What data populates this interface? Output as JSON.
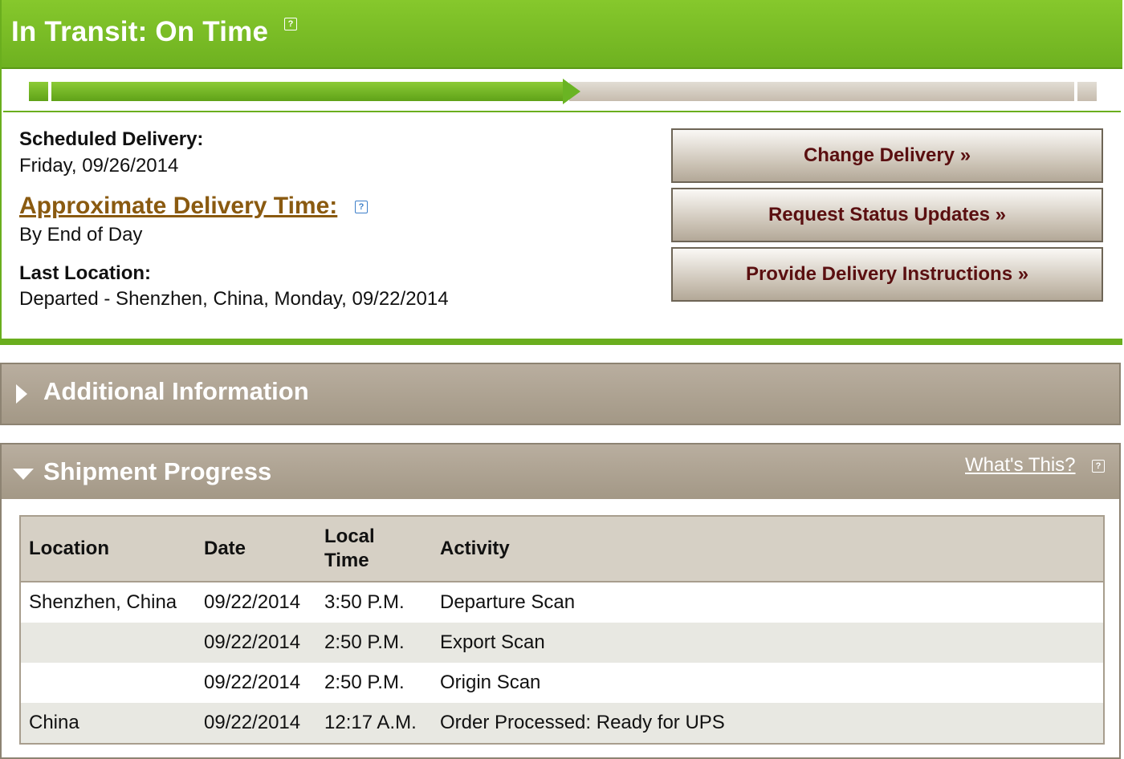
{
  "status": {
    "title": "In Transit: On Time",
    "help_icon": "help-icon",
    "progress_fraction": 0.5
  },
  "delivery": {
    "scheduled_label": "Scheduled Delivery:",
    "scheduled_value": "Friday, 09/26/2014",
    "approx_label": "Approximate Delivery Time:",
    "approx_value": "By End of Day",
    "last_location_label": "Last Location:",
    "last_location_value": "Departed - Shenzhen, China, Monday, 09/22/2014"
  },
  "actions": {
    "change_delivery": "Change Delivery »",
    "request_updates": "Request Status Updates »",
    "provide_instructions": "Provide Delivery Instructions »"
  },
  "additional_info": {
    "title": "Additional Information"
  },
  "shipment_progress": {
    "title": "Shipment Progress",
    "whats_this": "What's This?",
    "headers": [
      "Location",
      "Date",
      "Local\nTime",
      "Activity"
    ],
    "rows": [
      [
        "Shenzhen, China",
        "09/22/2014",
        "3:50 P.M.",
        "Departure Scan"
      ],
      [
        "",
        "09/22/2014",
        "2:50 P.M.",
        "Export Scan"
      ],
      [
        "",
        "09/22/2014",
        "2:50 P.M.",
        "Origin Scan"
      ],
      [
        "China",
        "09/22/2014",
        "12:17 A.M.",
        "Order Processed: Ready for UPS"
      ]
    ]
  },
  "colors": {
    "status_green": "#6eb120",
    "bar_taupe": "#a39886",
    "button_text": "#5a0f10",
    "link_brown": "#8a5a10"
  }
}
